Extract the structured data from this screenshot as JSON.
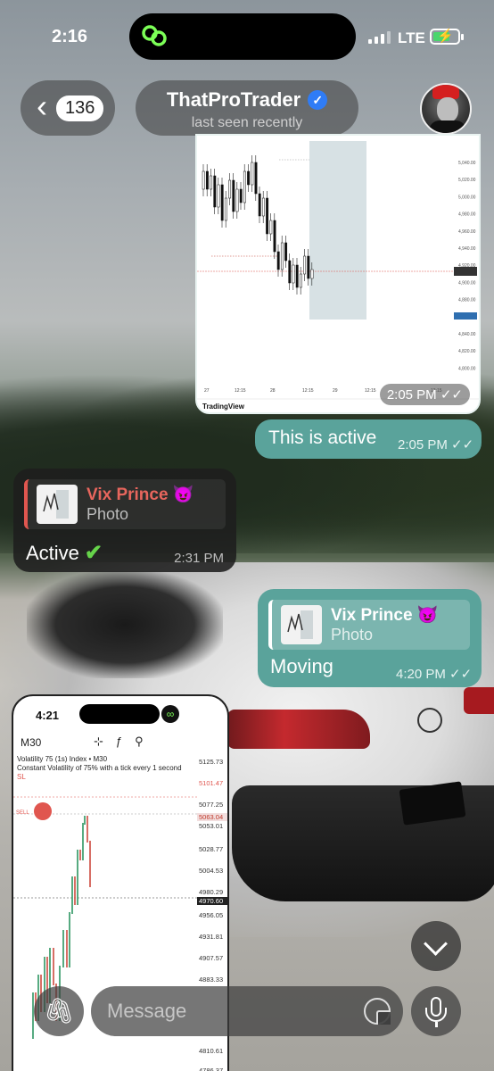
{
  "status_bar": {
    "time": "2:16",
    "network": "LTE"
  },
  "header": {
    "unread_count": "136",
    "contact_name": "ThatProTrader",
    "contact_status": "last seen recently"
  },
  "messages": {
    "chart_image": {
      "time": "2:05 PM",
      "source_label": "TradingView",
      "y_ticks": [
        "5,040.00",
        "5,020.00",
        "5,000.00",
        "4,980.00",
        "4,960.00",
        "4,940.00",
        "4,920.00",
        "4,900.00",
        "4,880.00",
        "4,860.00",
        "4,840.00",
        "4,820.00",
        "4,800.00"
      ],
      "x_ticks": [
        "27",
        "12:15",
        "28",
        "12:15",
        "29",
        "12:15",
        "12:15"
      ]
    },
    "msg1": {
      "text": "This is active",
      "time": "2:05 PM"
    },
    "reply_in": {
      "quote_name": "Vix Prince",
      "quote_emoji": "😈",
      "quote_kind": "Photo",
      "text": "Active",
      "time": "2:31 PM"
    },
    "msg2": {
      "quote_name": "Vix Prince",
      "quote_emoji": "😈",
      "quote_kind": "Photo",
      "text": "Moving",
      "time": "4:20 PM"
    },
    "phone_screenshot": {
      "time": "4:21",
      "timeframe": "M30",
      "instrument": "Volatility 75 (1s) Index • M30",
      "description": "Constant Volatility of 75% with a tick every 1 second",
      "sl_label": "SL",
      "sell_label": "SELL",
      "price_ticks": [
        "5125.73",
        "5101.47",
        "5077.25",
        "5063.04",
        "5053.01",
        "5028.77",
        "5004.53",
        "4980.29",
        "4970.60",
        "4956.05",
        "4931.81",
        "4907.57",
        "4883.33",
        "4810.61",
        "4786.37"
      ]
    }
  },
  "composer": {
    "placeholder": "Message"
  },
  "colors": {
    "outgoing": "#5aa39b",
    "incoming": "#1e1e1e",
    "accent_red": "#e0564f"
  }
}
